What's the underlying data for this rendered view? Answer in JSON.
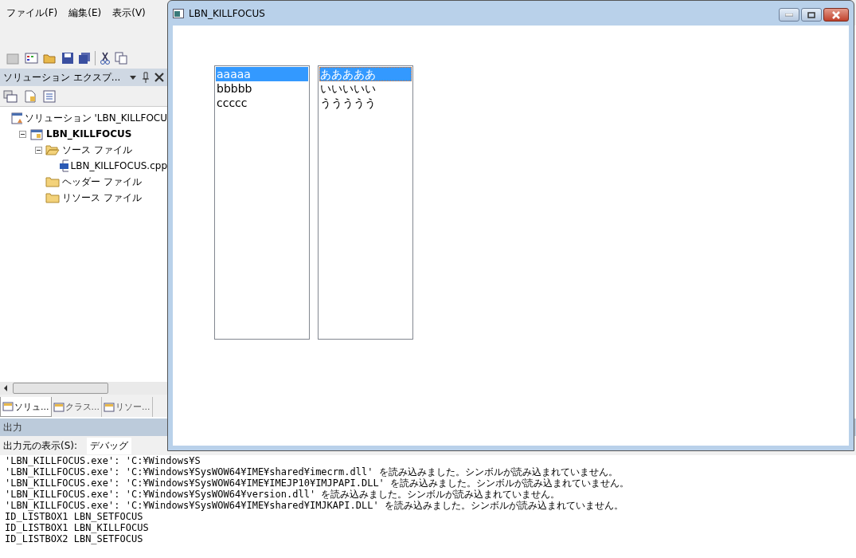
{
  "ide": {
    "menu": [
      "ファイル(F)",
      "編集(E)",
      "表示(V)"
    ],
    "solution_explorer": {
      "title": "ソリューション エクスプ...",
      "tree": [
        {
          "label": "ソリューション 'LBN_KILLFOCU",
          "kind": "solution",
          "children": [
            {
              "label": "LBN_KILLFOCUS",
              "kind": "project",
              "expanded": true,
              "children": [
                {
                  "label": "ソース ファイル",
                  "kind": "folder",
                  "expanded": true,
                  "children": [
                    {
                      "label": "LBN_KILLFOCUS.cpp",
                      "kind": "file"
                    }
                  ]
                },
                {
                  "label": "ヘッダー ファイル",
                  "kind": "folder",
                  "expanded": false
                },
                {
                  "label": "リソース ファイル",
                  "kind": "folder",
                  "expanded": false
                }
              ]
            }
          ]
        }
      ]
    },
    "tabs": [
      {
        "label": "ソリュ...",
        "selected": true
      },
      {
        "label": "クラス...",
        "selected": false
      },
      {
        "label": "リソー...",
        "selected": false
      }
    ],
    "output": {
      "title": "出力",
      "source_label": "出力元の表示(S):",
      "source_value": "デバッグ",
      "lines": [
        "'LBN_KILLFOCUS.exe': 'C:¥Windows¥S",
        "'LBN_KILLFOCUS.exe': 'C:¥Windows¥SysWOW64¥IME¥shared¥imecrm.dll' を読み込みました。シンボルが読み込まれていません。",
        "'LBN_KILLFOCUS.exe': 'C:¥Windows¥SysWOW64¥IME¥IMEJP10¥IMJPAPI.DLL' を読み込みました。シンボルが読み込まれていません。",
        "'LBN_KILLFOCUS.exe': 'C:¥Windows¥SysWOW64¥version.dll' を読み込みました。シンボルが読み込まれていません。",
        "'LBN_KILLFOCUS.exe': 'C:¥Windows¥SysWOW64¥IME¥shared¥IMJKAPI.DLL' を読み込みました。シンボルが読み込まれていません。",
        "ID_LISTBOX1 LBN_SETFOCUS",
        "ID_LISTBOX1 LBN_KILLFOCUS",
        "ID_LISTBOX2 LBN_SETFOCUS"
      ]
    }
  },
  "dialog": {
    "title": "LBN_KILLFOCUS",
    "listboxes": [
      {
        "focused": false,
        "items": [
          {
            "text": "aaaaa",
            "selected": true
          },
          {
            "text": "bbbbb",
            "selected": false
          },
          {
            "text": "ccccc",
            "selected": false
          }
        ]
      },
      {
        "focused": true,
        "items": [
          {
            "text": "あああああ",
            "selected": true
          },
          {
            "text": "いいいいい",
            "selected": false
          },
          {
            "text": "ううううう",
            "selected": false
          }
        ]
      }
    ]
  }
}
